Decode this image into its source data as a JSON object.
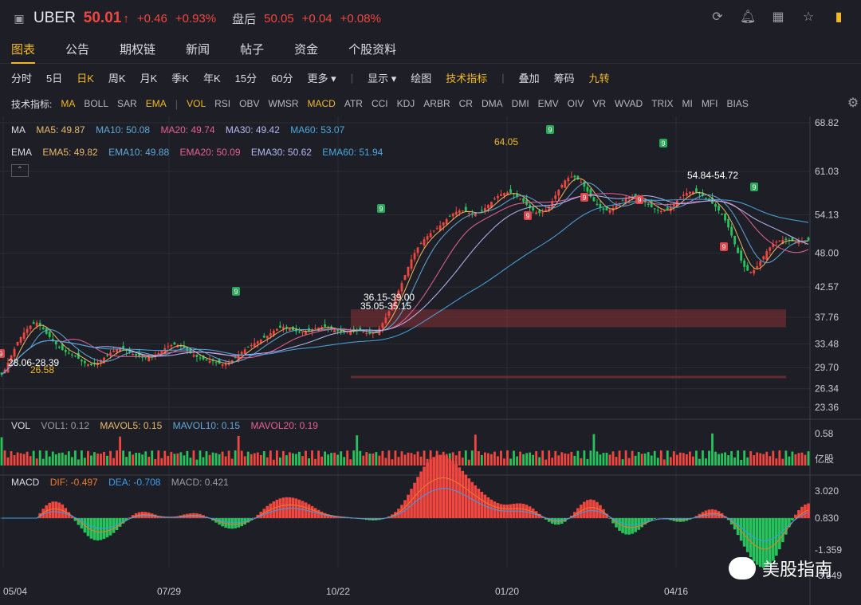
{
  "header": {
    "ticker": "UBER",
    "price": "50.01",
    "arrow": "↑",
    "change": "+0.46",
    "change_pct": "+0.93%",
    "after_hours_label": "盘后",
    "ah_price": "50.05",
    "ah_change": "+0.04",
    "ah_change_pct": "+0.08%",
    "icons": [
      "refresh-icon",
      "bell-icon",
      "grid-icon",
      "star-icon",
      "layout-icon"
    ]
  },
  "tabs": [
    "图表",
    "公告",
    "期权链",
    "新闻",
    "帖子",
    "资金",
    "个股资料"
  ],
  "active_tab": "图表",
  "tools": {
    "periods": [
      "分时",
      "5日",
      "日K",
      "周K",
      "月K",
      "季K",
      "年K",
      "15分",
      "60分",
      "更多 ▾"
    ],
    "active_period": "日K",
    "options": [
      "显示 ▾",
      "绘图",
      "技术指标"
    ],
    "extras": [
      "叠加",
      "筹码",
      "九转"
    ]
  },
  "indicators": {
    "label": "技术指标:",
    "main": [
      "MA",
      "BOLL",
      "SAR",
      "EMA"
    ],
    "sub": [
      "VOL",
      "RSI",
      "OBV",
      "WMSR",
      "MACD",
      "ATR",
      "CCI",
      "KDJ",
      "ARBR",
      "CR",
      "DMA",
      "DMI",
      "EMV",
      "OIV",
      "VR",
      "WVAD",
      "TRIX",
      "MI",
      "MFI",
      "BIAS"
    ],
    "active": [
      "MA",
      "EMA",
      "VOL",
      "MACD"
    ]
  },
  "legends": {
    "ma": {
      "name": "MA",
      "items": [
        {
          "text": "MA5: 49.87",
          "color": "#e8b86a"
        },
        {
          "text": "MA10: 50.08",
          "color": "#5fa8d8"
        },
        {
          "text": "MA20: 49.74",
          "color": "#e65f9a"
        },
        {
          "text": "MA30: 49.42",
          "color": "#b7b8f2"
        },
        {
          "text": "MA60: 53.07",
          "color": "#49a8e0"
        }
      ]
    },
    "ema": {
      "name": "EMA",
      "items": [
        {
          "text": "EMA5: 49.82",
          "color": "#e8b86a"
        },
        {
          "text": "EMA10: 49.88",
          "color": "#5fa8d8"
        },
        {
          "text": "EMA20: 50.09",
          "color": "#e65f9a"
        },
        {
          "text": "EMA30: 50.62",
          "color": "#b7b8f2"
        },
        {
          "text": "EMA60: 51.94",
          "color": "#49a8e0"
        }
      ]
    },
    "vol": {
      "name": "VOL",
      "items": [
        {
          "text": "VOL1: 0.12",
          "color": "#9a9ca6"
        },
        {
          "text": "MAVOL5: 0.15",
          "color": "#e8b86a"
        },
        {
          "text": "MAVOL10: 0.15",
          "color": "#5fa8d8"
        },
        {
          "text": "MAVOL20: 0.19",
          "color": "#e65f9a"
        }
      ]
    },
    "macd": {
      "name": "MACD",
      "items": [
        {
          "text": "DIF: -0.497",
          "color": "#f07a2d"
        },
        {
          "text": "DEA: -0.708",
          "color": "#3b9cf0"
        },
        {
          "text": "MACD: 0.421",
          "color": "#9a9ca6"
        }
      ]
    }
  },
  "chart_data": {
    "type": "candlestick",
    "price_axis": [
      "68.82",
      "61.03",
      "54.13",
      "48.00",
      "42.57",
      "37.76",
      "33.48",
      "29.70",
      "26.34",
      "23.36"
    ],
    "price_range": [
      23.36,
      68.82
    ],
    "vol_axis": [
      "0.58",
      "亿股"
    ],
    "macd_axis": [
      "3.020",
      "0.830",
      "-1.359",
      "-3.549"
    ],
    "x_labels": [
      "05/04",
      "07/29",
      "10/22",
      "01/20",
      "04/16"
    ],
    "annotations": [
      "64.05",
      "28.06-28.39",
      "26.58",
      "36.15-39.00",
      "35.05-35.15",
      "54.84-54.72"
    ],
    "td_labels": [
      "9",
      "9",
      "9",
      "9",
      "9",
      "9",
      "9",
      "9",
      "9",
      "9"
    ],
    "closes": [
      28.6,
      29.4,
      30.5,
      31.6,
      32.7,
      33.8,
      34.6,
      35.3,
      35.9,
      36.4,
      36.7,
      36.9,
      36.4,
      35.8,
      35.1,
      34.6,
      34.0,
      33.4,
      32.9,
      32.5,
      32.2,
      32.0,
      31.8,
      31.5,
      31.1,
      30.7,
      30.4,
      30.2,
      30.1,
      30.2,
      30.5,
      30.9,
      31.3,
      31.7,
      32.1,
      32.4,
      32.6,
      32.7,
      32.6,
      32.4,
      32.2,
      31.9,
      31.6,
      31.4,
      31.3,
      31.3,
      31.4,
      31.5,
      31.7,
      32.0,
      32.4,
      32.8,
      33.1,
      33.3,
      33.4,
      33.3,
      33.1,
      32.8,
      32.4,
      32.0,
      31.7,
      31.4,
      31.2,
      31.0,
      30.9,
      30.8,
      30.7,
      30.5,
      30.3,
      30.2,
      30.3,
      30.5,
      30.9,
      31.3,
      31.8,
      32.2,
      32.6,
      33.0,
      33.3,
      33.6,
      33.9,
      34.2,
      34.5,
      34.8,
      35.2,
      35.6,
      35.9,
      36.1,
      36.2,
      36.1,
      35.9,
      35.7,
      35.5,
      35.4,
      35.4,
      35.5,
      35.6,
      35.8,
      36.0,
      36.1,
      36.2,
      36.2,
      36.1,
      35.9,
      35.7,
      35.5,
      35.4,
      35.4,
      35.5,
      35.6,
      35.7,
      35.7,
      35.6,
      35.4,
      35.2,
      35.1,
      35.2,
      35.5,
      36.0,
      36.8,
      37.7,
      38.7,
      39.8,
      40.9,
      42.0,
      43.2,
      44.5,
      45.8,
      47.0,
      48.0,
      48.9,
      49.6,
      50.2,
      50.7,
      51.2,
      51.6,
      52.0,
      52.4,
      52.9,
      53.4,
      53.9,
      54.3,
      54.6,
      54.8,
      54.8,
      54.6,
      54.4,
      54.3,
      54.3,
      54.5,
      54.8,
      55.2,
      55.7,
      56.2,
      56.7,
      57.1,
      57.4,
      57.6,
      57.7,
      57.6,
      57.4,
      57.1,
      56.7,
      56.2,
      55.7,
      55.2,
      54.8,
      54.5,
      54.4,
      54.5,
      54.9,
      55.5,
      56.3,
      57.2,
      58.1,
      58.9,
      59.6,
      60.0,
      60.2,
      60.1,
      59.8,
      59.3,
      58.6,
      57.8,
      57.0,
      56.3,
      55.7,
      55.2,
      54.9,
      54.8,
      54.9,
      55.2,
      55.6,
      56.0,
      56.4,
      56.7,
      56.9,
      57.0,
      57.0,
      56.8,
      56.5,
      56.1,
      55.7,
      55.3,
      55.0,
      54.8,
      54.7,
      54.8,
      55.0,
      55.4,
      55.9,
      56.4,
      56.9,
      57.3,
      57.6,
      57.8,
      57.8,
      57.7,
      57.5,
      57.2,
      56.8,
      56.4,
      55.9,
      55.4,
      54.8,
      54.1,
      53.2,
      52.1,
      50.8,
      49.4,
      48.0,
      46.8,
      45.8,
      45.2,
      45.0,
      45.3,
      45.9,
      46.7,
      47.5,
      48.3,
      48.9,
      49.4,
      49.8,
      50.0,
      50.1,
      50.1,
      50.0,
      49.9,
      49.8,
      49.8,
      49.9,
      50.0,
      50.01
    ],
    "ma_periods": [
      5,
      10,
      20,
      30,
      60
    ],
    "ema_periods": [
      5,
      10,
      20,
      30,
      60
    ],
    "support_zones": [
      {
        "from": 36.15,
        "to": 39.0
      },
      {
        "from": 28.06,
        "to": 28.39
      }
    ],
    "grid": true
  },
  "watermark": "美股指南"
}
